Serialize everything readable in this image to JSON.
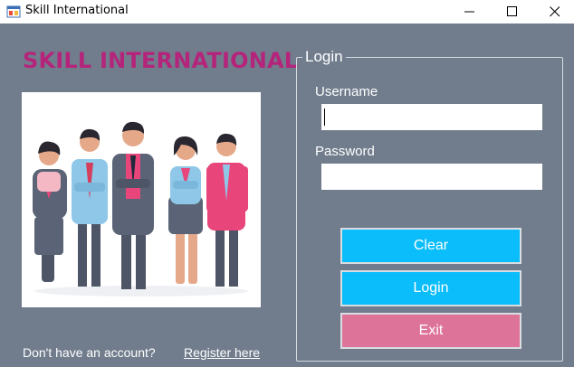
{
  "window": {
    "title": "Skill International"
  },
  "brand": {
    "heading": "SKILL INTERNATIONAL"
  },
  "login": {
    "legend": "Login",
    "username_label": "Username",
    "username_value": "",
    "password_label": "Password",
    "password_value": ""
  },
  "buttons": {
    "clear": "Clear",
    "login": "Login",
    "exit": "Exit"
  },
  "footer": {
    "prompt": "Don't have an account?",
    "register_link": "Register here"
  },
  "colors": {
    "background": "#717d8d",
    "brand_text": "#b5247b",
    "primary_button": "#0bbdfa",
    "exit_button": "#de7399"
  },
  "icons": {
    "app": "app-window-icon",
    "minimize": "minimize-icon",
    "maximize": "maximize-icon",
    "close": "close-icon",
    "illustration": "team-of-people-illustration"
  }
}
